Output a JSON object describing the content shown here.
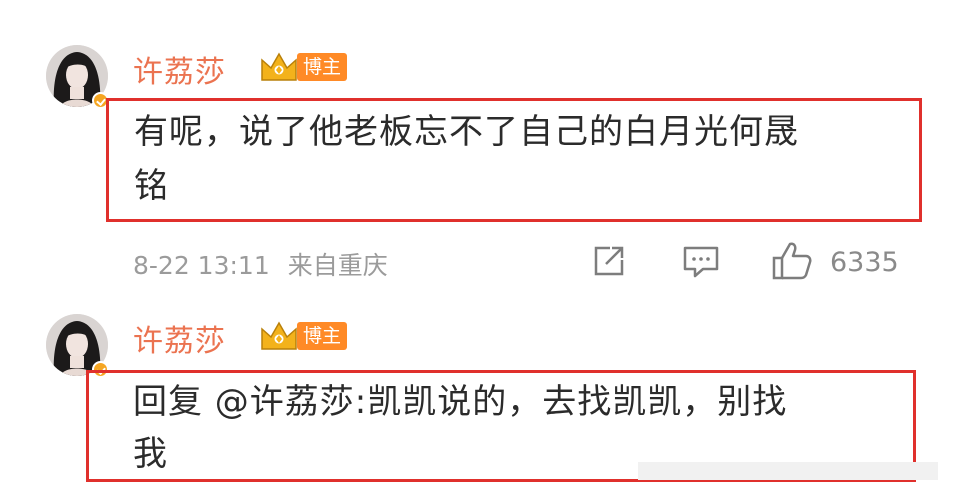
{
  "comments": [
    {
      "username": "许荔莎",
      "badge": "博主",
      "text_line1": "有呢，说了他老板忘不了自己的白月光何晟",
      "text_line2": "铭",
      "date": "8-22 13:11",
      "location": "来自重庆",
      "like_count": "6335"
    },
    {
      "username": "许荔莎",
      "badge": "博主",
      "text_line1": "回复 @许荔莎:凯凯说的，去找凯凯，别找",
      "text_line2": "我"
    }
  ],
  "icons": {
    "share": "share-icon",
    "comment": "comment-icon",
    "like": "thumbs-up-icon",
    "crown": "crown-icon",
    "verified": "verified-icon"
  },
  "colors": {
    "username": "#eb7350",
    "highlight_border": "#e0302c",
    "badge": "#ff8a26",
    "verified": "#f5a623",
    "meta": "#9b9b9b"
  }
}
